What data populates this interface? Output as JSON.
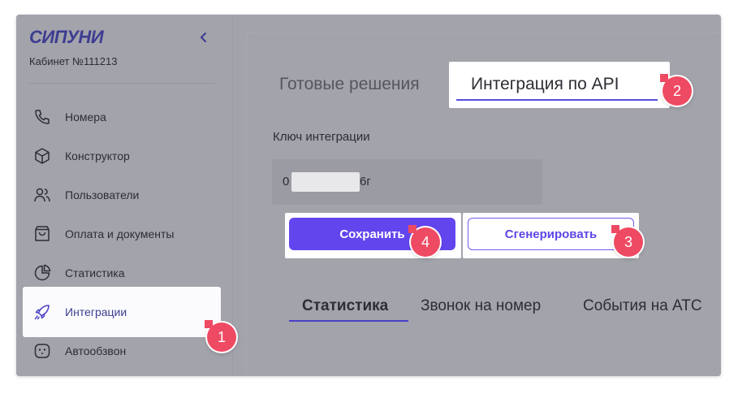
{
  "sidebar": {
    "logo": "СИПУНИ",
    "cabinet": "Кабинет №111213",
    "items": [
      {
        "label": "Номера",
        "icon": "phone-icon"
      },
      {
        "label": "Конструктор",
        "icon": "cube-icon"
      },
      {
        "label": "Пользователи",
        "icon": "users-icon"
      },
      {
        "label": "Оплата и документы",
        "icon": "shopping-bag-icon"
      },
      {
        "label": "Статистика",
        "icon": "pie-chart-icon"
      },
      {
        "label": "Интеграции",
        "icon": "rocket-icon",
        "active": true
      },
      {
        "label": "Автообзвон",
        "icon": "robot-icon"
      }
    ]
  },
  "main": {
    "tabs": [
      "Готовые решения",
      "Интеграция по API"
    ],
    "active_tab": "Интеграция по API",
    "key_label": "Ключ интеграции",
    "key_value_start": "0",
    "key_value_end": "6г",
    "save_label": "Сохранить",
    "generate_label": "Сгенерировать",
    "sub_tabs": [
      "Статистика",
      "Звонок на номер",
      "События на АТС"
    ],
    "active_sub_tab": "Статистика"
  },
  "badges": [
    "1",
    "2",
    "3",
    "4"
  ],
  "colors": {
    "accent": "#6345ee",
    "badge": "#ef4a63",
    "overlay": "#a2a3ab",
    "logo": "#3d3c91"
  }
}
